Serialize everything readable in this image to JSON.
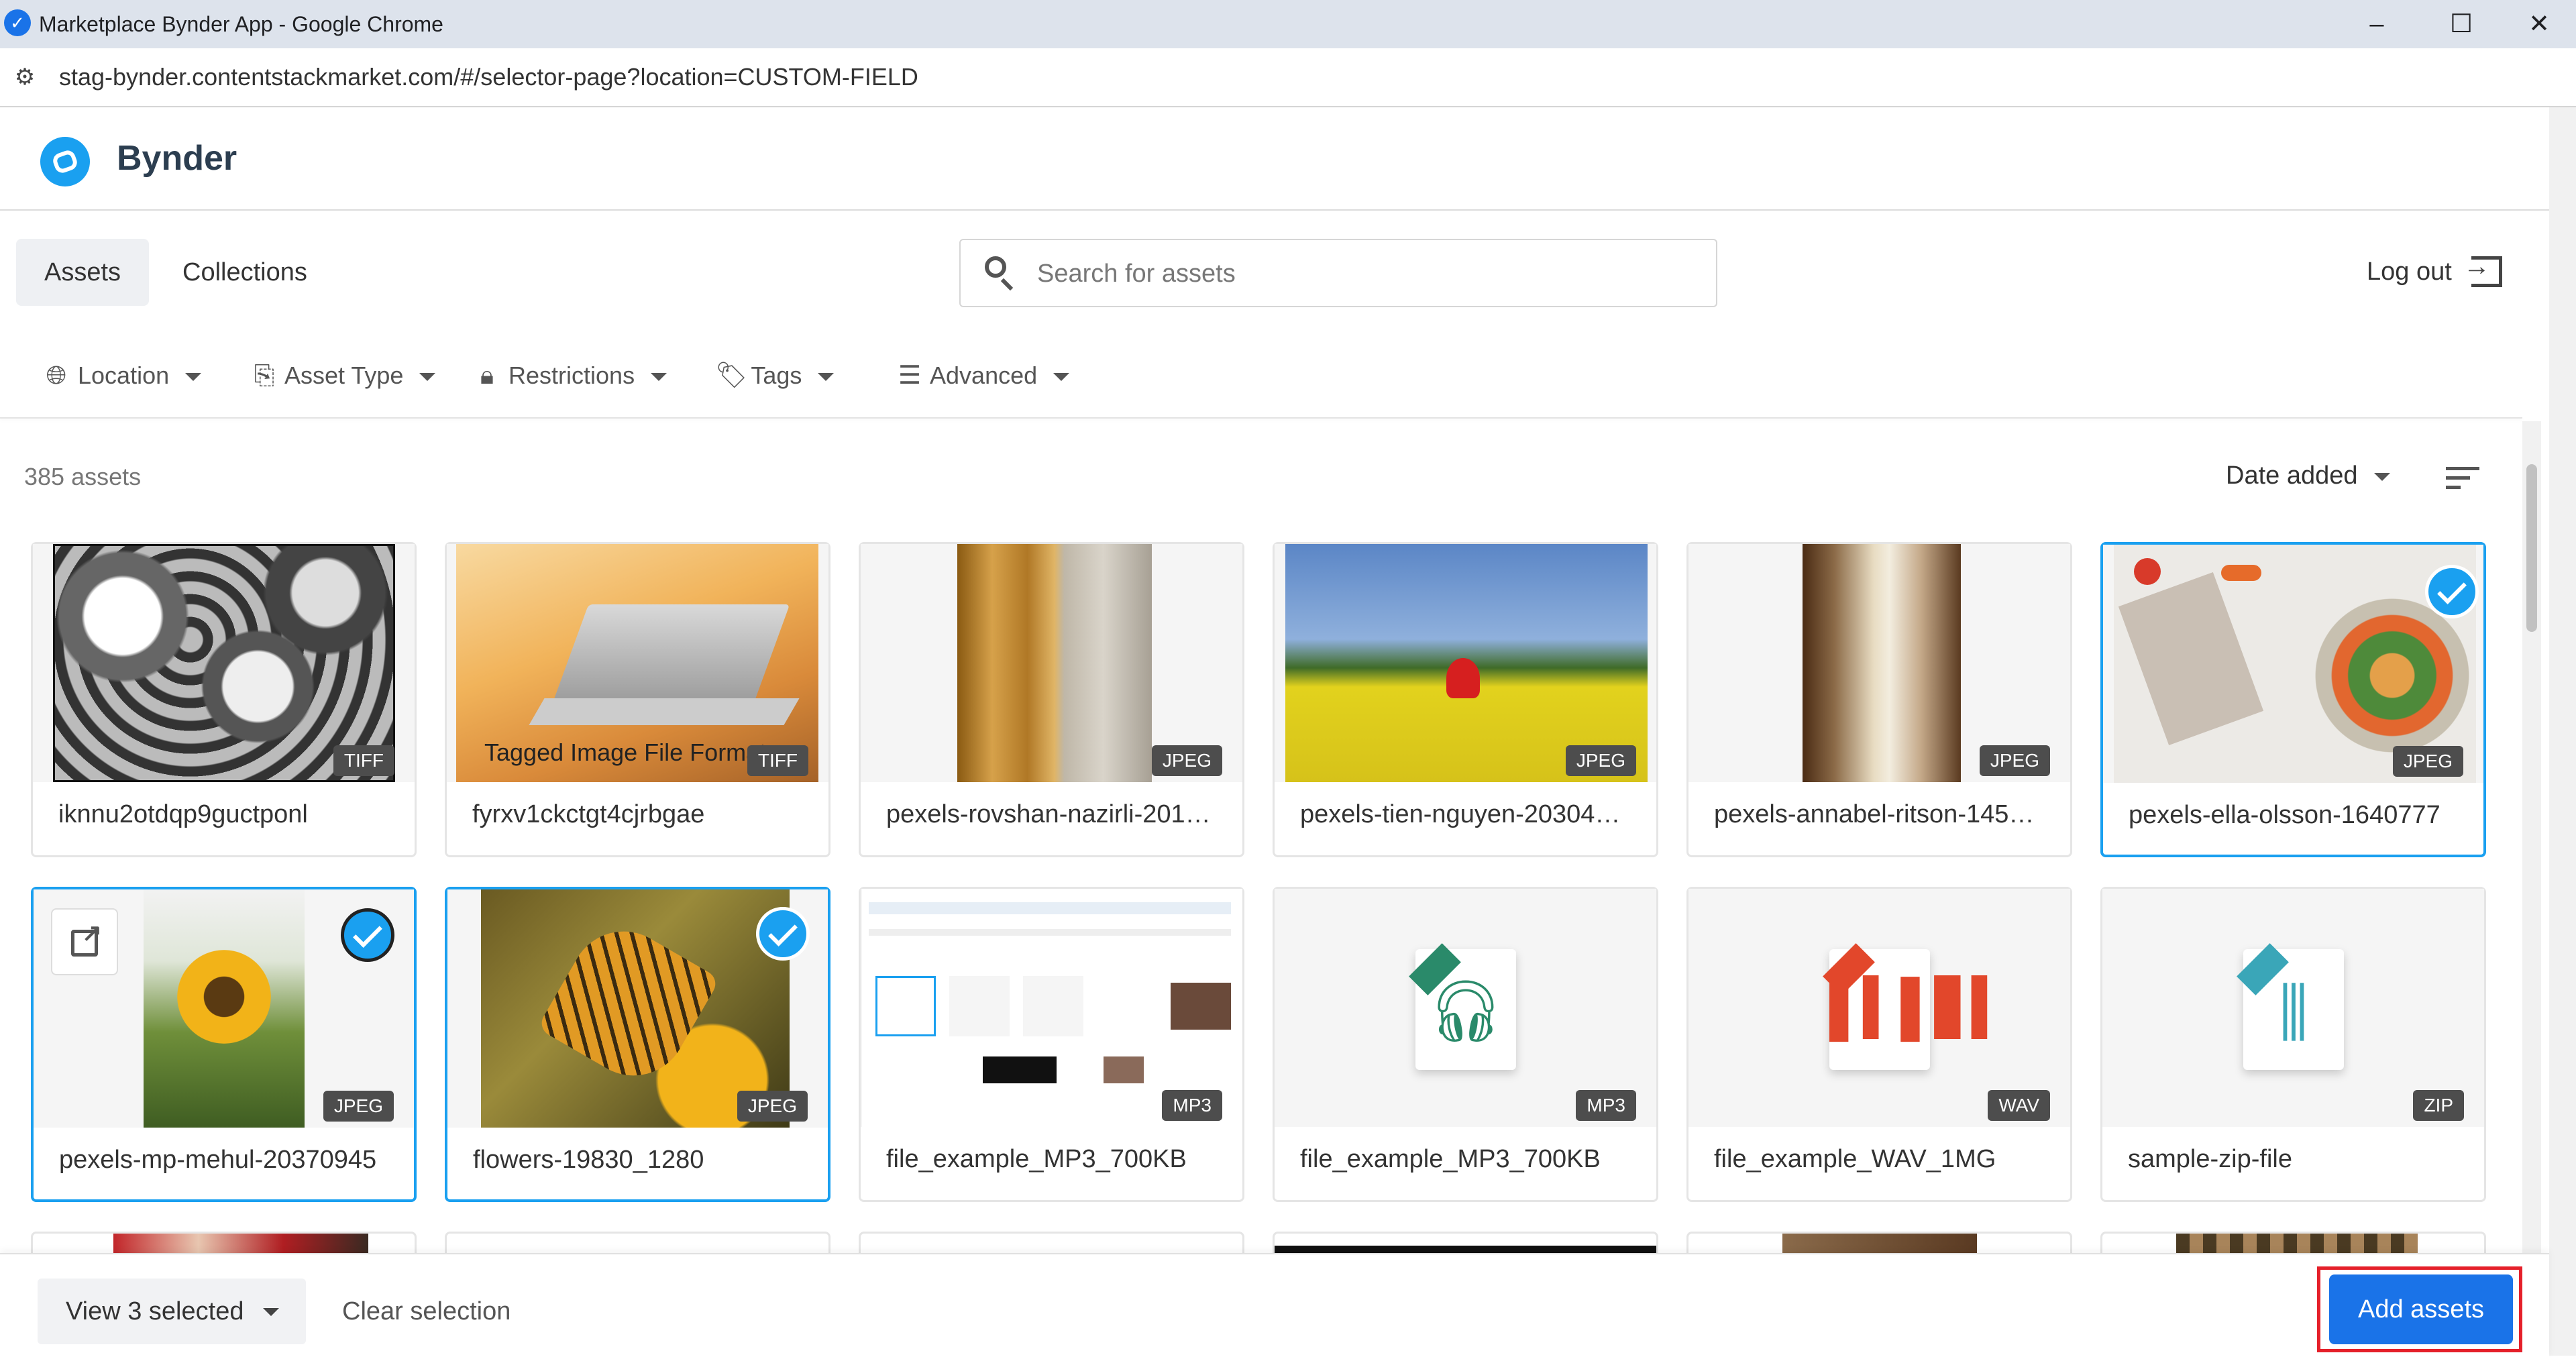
{
  "window": {
    "title": "Marketplace Bynder App - Google Chrome",
    "controls": {
      "minimize": "–",
      "maximize": "☐",
      "close": "✕"
    }
  },
  "address_bar": {
    "url": "stag-bynder.contentstackmarket.com/#/selector-page?location=CUSTOM-FIELD"
  },
  "app": {
    "brand": "Bynder",
    "tabs": [
      {
        "label": "Assets",
        "active": true
      },
      {
        "label": "Collections",
        "active": false
      }
    ],
    "search": {
      "placeholder": "Search for assets",
      "value": ""
    },
    "logout_label": "Log out",
    "filters": [
      {
        "label": "Location",
        "icon": "globe-icon"
      },
      {
        "label": "Asset Type",
        "icon": "paperclip-icon"
      },
      {
        "label": "Restrictions",
        "icon": "lock-icon"
      },
      {
        "label": "Tags",
        "icon": "tag-icon"
      },
      {
        "label": "Advanced",
        "icon": "sliders-icon"
      }
    ],
    "asset_count": "385 assets",
    "sort": {
      "label": "Date added"
    },
    "accent_color": "#1aa0f0",
    "button_color": "#1a73e8",
    "assets": [
      {
        "name": "iknnu2otdqp9guctponl",
        "type": "TIFF",
        "selected": false
      },
      {
        "name": "fyrxv1ckctgt4cjrbgae",
        "type": "TIFF",
        "selected": false,
        "overlay_text": "Tagged Image File Format"
      },
      {
        "name": "pexels-rovshan-nazirli-201…",
        "type": "JPEG",
        "selected": false
      },
      {
        "name": "pexels-tien-nguyen-20304…",
        "type": "JPEG",
        "selected": false
      },
      {
        "name": "pexels-annabel-ritson-145…",
        "type": "JPEG",
        "selected": false
      },
      {
        "name": "pexels-ella-olsson-1640777",
        "type": "JPEG",
        "selected": true
      },
      {
        "name": "pexels-mp-mehul-20370945",
        "type": "JPEG",
        "selected": true
      },
      {
        "name": "flowers-19830_1280",
        "type": "JPEG",
        "selected": true
      },
      {
        "name": "file_example_MP3_700KB",
        "type": "MP3",
        "selected": false
      },
      {
        "name": "file_example_MP3_700KB",
        "type": "MP3",
        "selected": false
      },
      {
        "name": "file_example_WAV_1MG",
        "type": "WAV",
        "selected": false
      },
      {
        "name": "sample-zip-file",
        "type": "ZIP",
        "selected": false
      }
    ]
  },
  "bottom_bar": {
    "view_selected": "View 3 selected",
    "clear_selection": "Clear selection",
    "add_assets": "Add assets"
  }
}
